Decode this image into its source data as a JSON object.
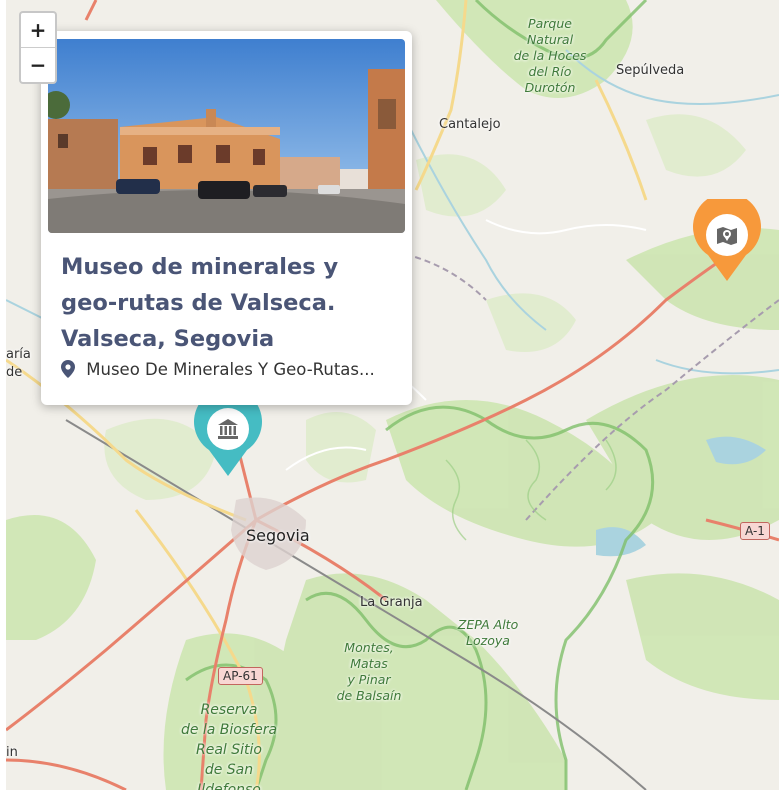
{
  "zoom": {
    "in_label": "+",
    "out_label": "−"
  },
  "popup": {
    "title": "Museo de minerales y geo-rutas de Valseca. Valseca, Segovia",
    "address": "Museo De Minerales Y Geo-Rutas..."
  },
  "markers": [
    {
      "icon": "museum-icon",
      "color": "#45bcc3"
    },
    {
      "icon": "map-icon",
      "color": "#f7993b"
    }
  ],
  "map_labels": {
    "segovia": "Segovia",
    "cantalejo": "Cantalejo",
    "sepulveda": "Sepúlveda",
    "la_granja": "La Granja",
    "parque": "Parque\nNatural\nde la Hoces\ndel Río\nDurotón",
    "zepa": "ZEPA Alto\nLozoya",
    "montes": "Montes,\nMatas\ny Pinar\nde Balsaín",
    "reserva": "Reserva\nde la Biosfera\nReal Sitio\nde San\nIldefonso",
    "edge1": "aría\nde",
    "edge2": "in"
  },
  "road_shields": {
    "ap61": "AP-61",
    "a1": "A-1"
  },
  "colors": {
    "popup_title": "#4a5576",
    "map_land": "#f1efe9",
    "forest": "#cde5b1",
    "road_primary": "#e8816b"
  }
}
